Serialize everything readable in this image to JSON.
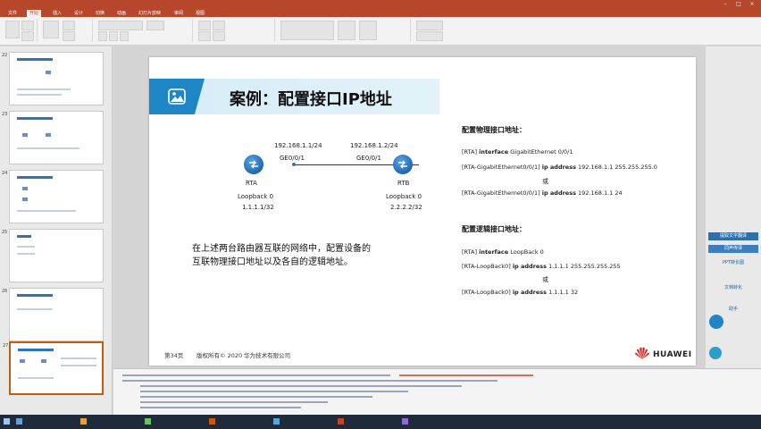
{
  "app": {
    "window_title": "",
    "tabs": [
      "文件",
      "开始",
      "插入",
      "设计",
      "切换",
      "动画",
      "幻灯片放映",
      "审阅",
      "视图"
    ],
    "active_tab": 1
  },
  "slide": {
    "title": "案例：配置接口IP地址",
    "rta": {
      "name": "RTA",
      "ip": "192.168.1.1/24",
      "port": "GE0/0/1",
      "loopback_label": "Loopback 0",
      "loopback_ip": "1.1.1.1/32"
    },
    "rtb": {
      "name": "RTB",
      "ip": "192.168.1.2/24",
      "port": "GE0/0/1",
      "loopback_label": "Loopback 0",
      "loopback_ip": "2.2.2.2/32"
    },
    "description": [
      "在上述两台路由器互联的网络中，配置设备的",
      "互联物理接口地址以及各自的逻辑地址。"
    ],
    "physical": {
      "heading": "配置物理接口地址：",
      "line1_prefix": "[RTA] ",
      "line1_cmd": "interface",
      "line1_arg": " GigabitEthernet 0/0/1",
      "line2_prefix": "[RTA-GigabitEthernet0/0/1] ",
      "line2_cmd": "ip address",
      "line2_arg": " 192.168.1.1 255.255.255.0",
      "or": "或",
      "line3_prefix": "[RTA-GigabitEthernet0/0/1] ",
      "line3_cmd": "ip address",
      "line3_arg": " 192.168.1.1 24"
    },
    "logical": {
      "heading": "配置逻辑接口地址：",
      "line1_prefix": "[RTA] ",
      "line1_cmd": "interface",
      "line1_arg": " LoopBack 0",
      "line2_prefix": "[RTA-LoopBack0] ",
      "line2_cmd": "ip address",
      "line2_arg": " 1.1.1.1 255.255.255.255",
      "or": "或",
      "line3_prefix": "[RTA-LoopBack0] ",
      "line3_cmd": "ip address",
      "line3_arg": " 1.1.1.1 32"
    },
    "footer_page": "第34页",
    "footer_copy": "版权所有© 2020 华为技术有限公司",
    "logo_text": "HUAWEI"
  },
  "thumbnails": {
    "numbers": [
      "22",
      "23",
      "24",
      "25",
      "26",
      "27"
    ],
    "selected_index": 5
  },
  "right_panel": {
    "buttons": [
      "提取文字翻译",
      "同声传译"
    ],
    "links": [
      "PPT转长图",
      "文档转化",
      "助手"
    ]
  },
  "taskbar": {
    "items": [
      "",
      "",
      "",
      "",
      "",
      "",
      ""
    ]
  },
  "colors": {
    "accent": "#1f86c6",
    "ribbon": "#b7472a",
    "selection": "#c55a11"
  }
}
